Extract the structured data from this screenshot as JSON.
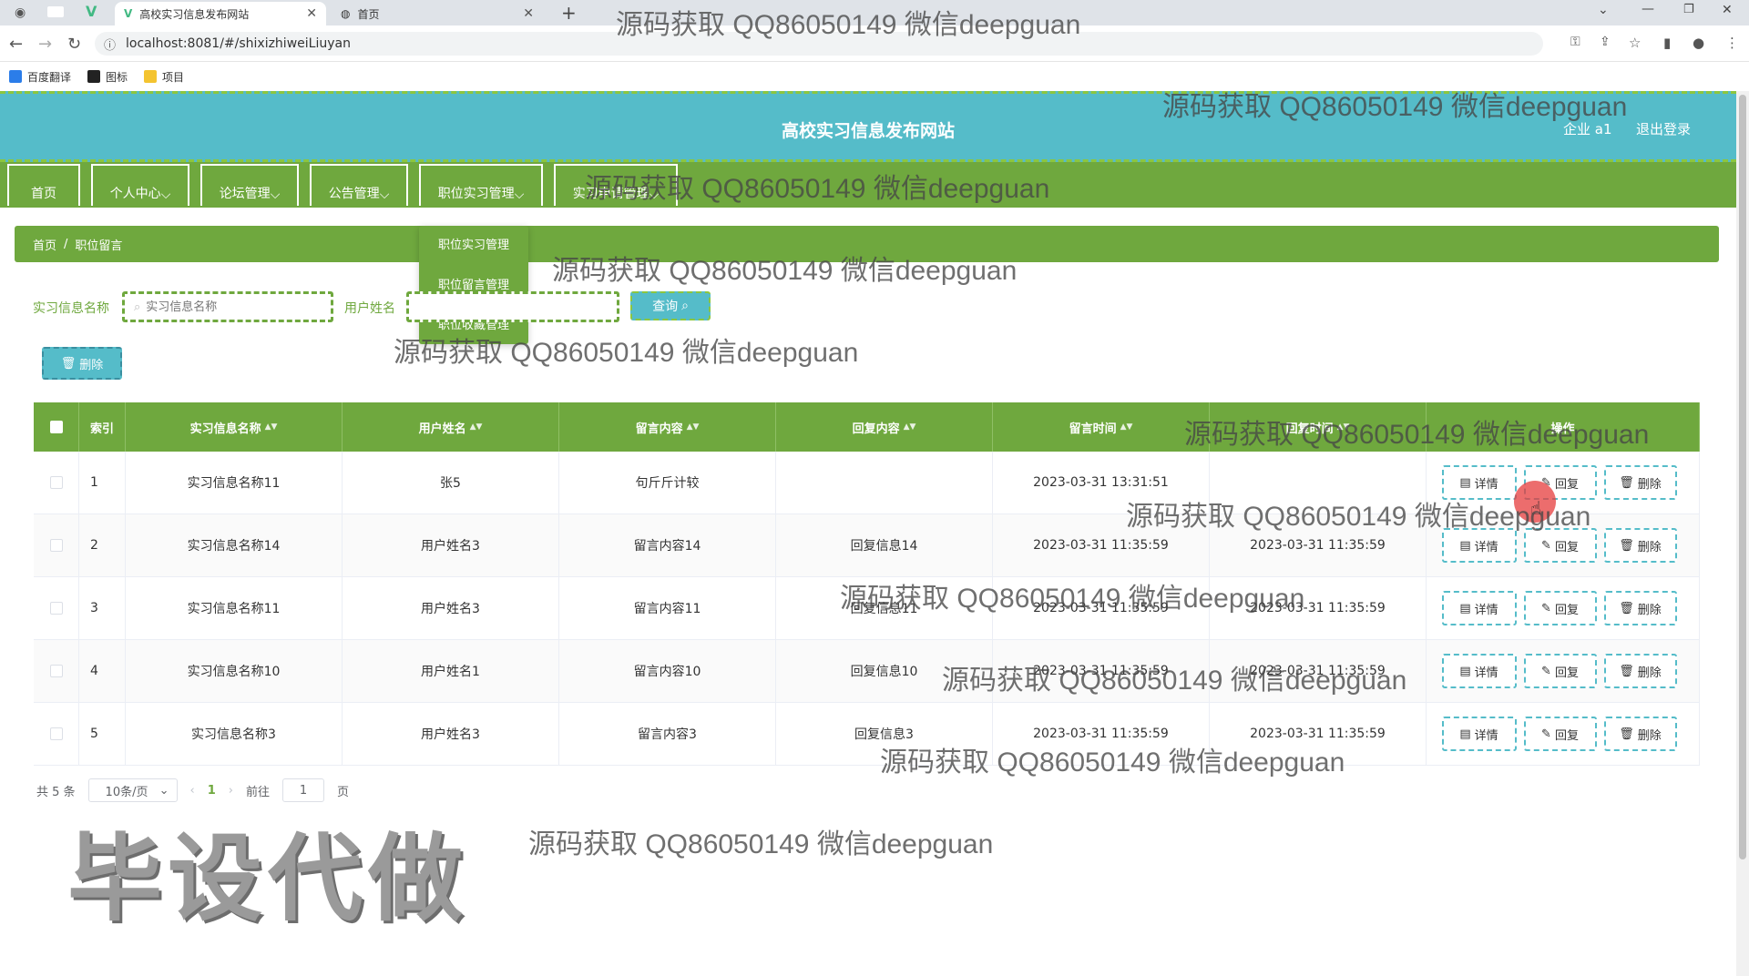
{
  "browser": {
    "tabs": [
      {
        "label": "高校实习信息发布网站",
        "active": true
      },
      {
        "label": "首页",
        "active": false
      }
    ],
    "url": "localhost:8081/#/shixizhiweiLiuyan",
    "bookmarks": [
      "百度翻译",
      "图标",
      "项目"
    ]
  },
  "header": {
    "title": "高校实习信息发布网站",
    "user": "企业 a1",
    "logout": "退出登录"
  },
  "nav": {
    "items": [
      "首页",
      "个人中心",
      "论坛管理",
      "公告管理",
      "职位实习管理",
      "实习申请管理"
    ],
    "dropdown": [
      "职位实习管理",
      "职位留言管理",
      "职位收藏管理"
    ]
  },
  "breadcrumb": {
    "home": "首页",
    "separator": "/",
    "current": "职位留言"
  },
  "search": {
    "label1": "实习信息名称",
    "placeholder1": "实习信息名称",
    "label2": "用户姓名",
    "button": "查询"
  },
  "toolbar": {
    "batch_delete": "删除"
  },
  "table": {
    "headers": [
      "索引",
      "实习信息名称",
      "用户姓名",
      "留言内容",
      "回复内容",
      "留言时间",
      "回复时间",
      "操作"
    ],
    "rows": [
      {
        "index": "1",
        "name": "实习信息名称11",
        "user": "张5",
        "content": "句斤斤计较",
        "reply": "",
        "time": "2023-03-31 13:31:51",
        "reply_time": ""
      },
      {
        "index": "2",
        "name": "实习信息名称14",
        "user": "用户姓名3",
        "content": "留言内容14",
        "reply": "回复信息14",
        "time": "2023-03-31 11:35:59",
        "reply_time": "2023-03-31 11:35:59"
      },
      {
        "index": "3",
        "name": "实习信息名称11",
        "user": "用户姓名3",
        "content": "留言内容11",
        "reply": "回复信息11",
        "time": "2023-03-31 11:35:59",
        "reply_time": "2023-03-31 11:35:59"
      },
      {
        "index": "4",
        "name": "实习信息名称10",
        "user": "用户姓名1",
        "content": "留言内容10",
        "reply": "回复信息10",
        "time": "2023-03-31 11:35:59",
        "reply_time": "2023-03-31 11:35:59"
      },
      {
        "index": "5",
        "name": "实习信息名称3",
        "user": "用户姓名3",
        "content": "留言内容3",
        "reply": "回复信息3",
        "time": "2023-03-31 11:35:59",
        "reply_time": "2023-03-31 11:35:59"
      }
    ],
    "actions": {
      "detail": "详情",
      "reply": "回复",
      "delete": "删除"
    }
  },
  "pagination": {
    "total": "共 5 条",
    "page_size": "10条/页",
    "current": "1",
    "goto_prefix": "前往",
    "goto_value": "1",
    "goto_suffix": "页"
  },
  "watermarks": {
    "text": "源码获取 QQ86050149 微信deepguan",
    "big": "毕设代做"
  }
}
